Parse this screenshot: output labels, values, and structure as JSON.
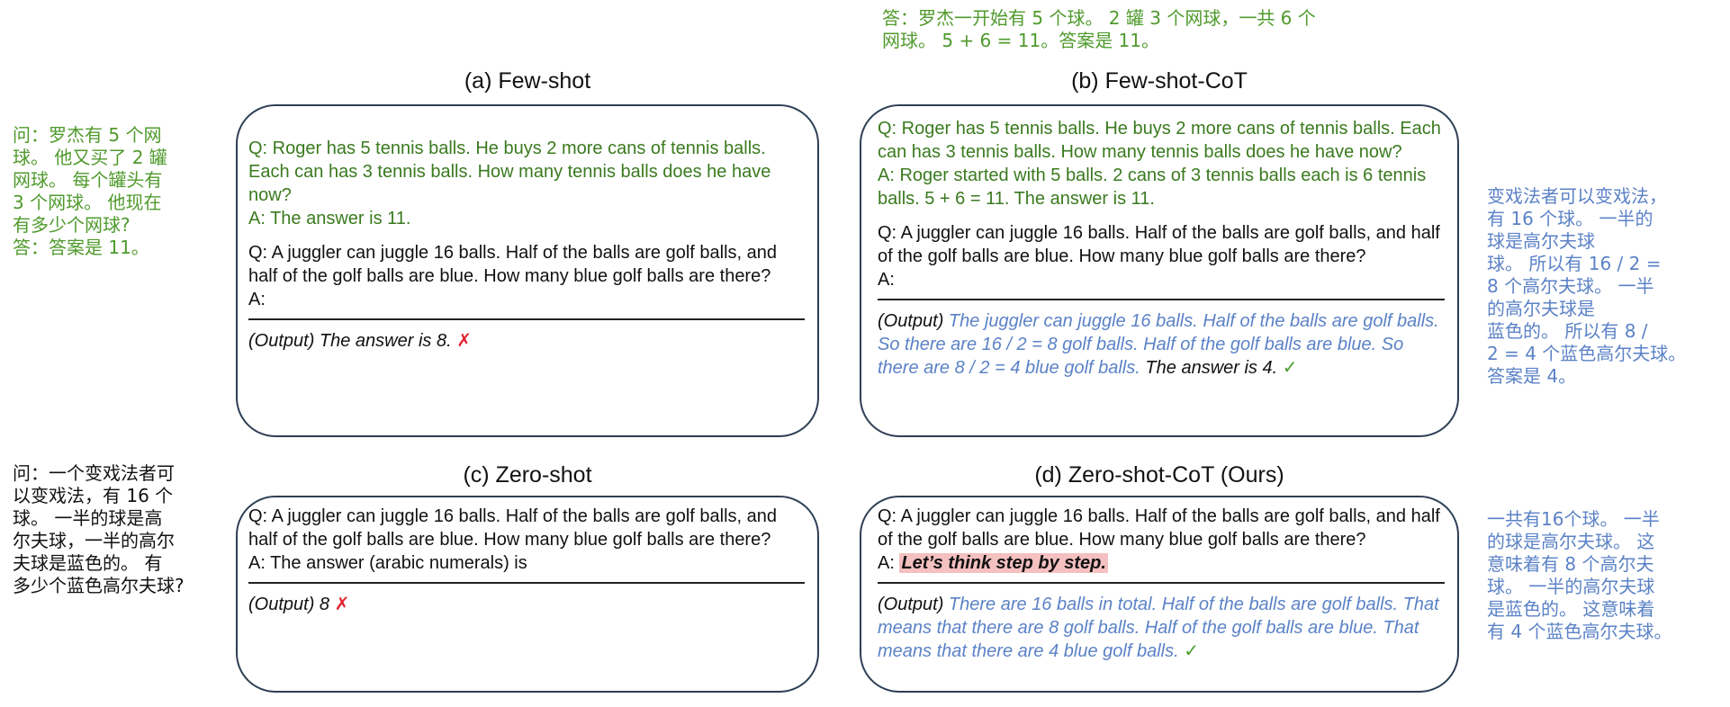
{
  "notes": {
    "top_center": "答：罗杰一开始有 5 个球。 2 罐 3 个网球，一共 6 个\n网球。 5 + 6 = 11。答案是 11。",
    "left_top": "问：罗杰有 5 个网\n球。 他又买了 2 罐\n网球。 每个罐头有\n3 个网球。 他现在\n有多少个网球?\n答：答案是 11。",
    "left_bottom": "问：一个变戏法者可\n以变戏法，有 16 个\n球。 一半的球是高\n尔夫球，一半的高尔\n夫球是蓝色的。 有\n多少个蓝色高尔夫球?",
    "right_top": "变戏法者可以变戏法，\n有 16 个球。 一半的\n球是高尔夫球\n球。 所以有 16 / 2 =\n8 个高尔夫球。 一半\n的高尔夫球是\n蓝色的。 所以有 8 /\n2 = 4 个蓝色高尔夫球。\n答案是 4。",
    "right_bottom": "一共有16个球。 一半\n的球是高尔夫球。 这\n意味着有 8 个高尔夫\n球。 一半的高尔夫球\n是蓝色的。 这意味着\n有 4 个蓝色高尔夫球。"
  },
  "panels": {
    "a": {
      "title": "(a) Few-shot",
      "q1": "Q: Roger has 5 tennis balls. He buys 2 more cans of tennis balls. Each can has 3 tennis balls. How many tennis balls does he have now?",
      "a1": "A: The answer is 11.",
      "q2": "Q: A juggler can juggle 16 balls. Half of the balls are golf balls, and half of the golf balls are blue. How many blue golf balls are there?",
      "a2": "A:",
      "output": "(Output) The answer is 8.",
      "mark": "✗"
    },
    "b": {
      "title": "(b) Few-shot-CoT",
      "q1": "Q: Roger has 5 tennis balls. He buys 2 more cans of tennis balls. Each can has 3 tennis balls. How many tennis balls does he have now?",
      "a1": "A: Roger started with 5 balls. 2 cans of 3 tennis balls each is 6 tennis balls. 5 + 6 = 11. The answer is 11.",
      "q2": "Q: A juggler can juggle 16 balls. Half of the balls are golf balls, and half of the golf balls are blue. How many blue golf balls are there?",
      "a2": "A:",
      "output_label": "(Output)",
      "output_reasoning": "The juggler can juggle 16 balls. Half of the balls are golf balls. So there are 16 / 2 = 8 golf balls. Half of the golf balls are blue. So there are 8 / 2 = 4 blue golf balls.",
      "output_answer": "The answer is 4.",
      "mark": "✓"
    },
    "c": {
      "title": "(c) Zero-shot",
      "q": "Q: A juggler can juggle 16 balls. Half of the balls are golf balls, and half of the golf balls are blue. How many blue golf balls are there?",
      "a": "A: The answer (arabic numerals) is",
      "output": "(Output) 8",
      "mark": "✗"
    },
    "d": {
      "title": "(d) Zero-shot-CoT (Ours)",
      "q": "Q: A juggler can juggle 16 balls. Half of the balls are golf balls, and half of the golf balls are blue. How many blue golf balls are there?",
      "a_prefix": "A:",
      "a_trigger": "Let’s think step by step.",
      "output_label": "(Output)",
      "output_reasoning": "There are 16 balls in total. Half of the balls are golf balls. That means that there are 8 golf balls. Half of the golf balls are blue. That means that there are 4 blue golf balls.",
      "mark": "✓"
    }
  }
}
